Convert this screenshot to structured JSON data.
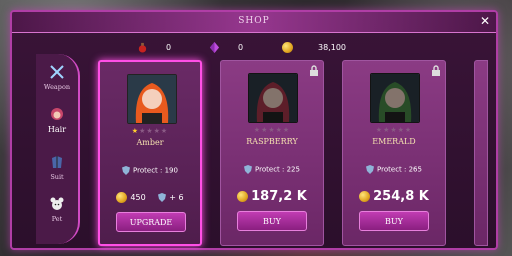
{
  "shop": {
    "title": "SHOP",
    "close": "✕"
  },
  "currencies": [
    {
      "icon": "potion-icon",
      "value": "0"
    },
    {
      "icon": "gem-icon",
      "value": "0"
    },
    {
      "icon": "coin-icon",
      "value": "38,100"
    }
  ],
  "sidebar": [
    {
      "label": "Weapon",
      "icon": "sword-icon",
      "active": false
    },
    {
      "label": "Hair",
      "icon": "hair-icon",
      "active": true
    },
    {
      "label": "Suit",
      "icon": "suit-icon",
      "active": false
    },
    {
      "label": "Pet",
      "icon": "pet-icon",
      "active": false
    }
  ],
  "cards": [
    {
      "name": "Amber",
      "stars": 1,
      "max_stars": 5,
      "protect": "Protect : 190",
      "price": "450",
      "bonus": "+ 6",
      "button": "Upgrade",
      "locked": false,
      "selected": true,
      "hair_color": "#e85a1e"
    },
    {
      "name": "Raspberry",
      "stars": 0,
      "max_stars": 5,
      "protect": "Protect : 225",
      "price": "187,2 K",
      "button": "Buy",
      "locked": true,
      "selected": false,
      "hair_color": "#c0304a"
    },
    {
      "name": "Emerald",
      "stars": 0,
      "max_stars": 5,
      "protect": "Protect : 265",
      "price": "254,8 K",
      "button": "Buy",
      "locked": true,
      "selected": false,
      "hair_color": "#3e8e3a"
    }
  ]
}
